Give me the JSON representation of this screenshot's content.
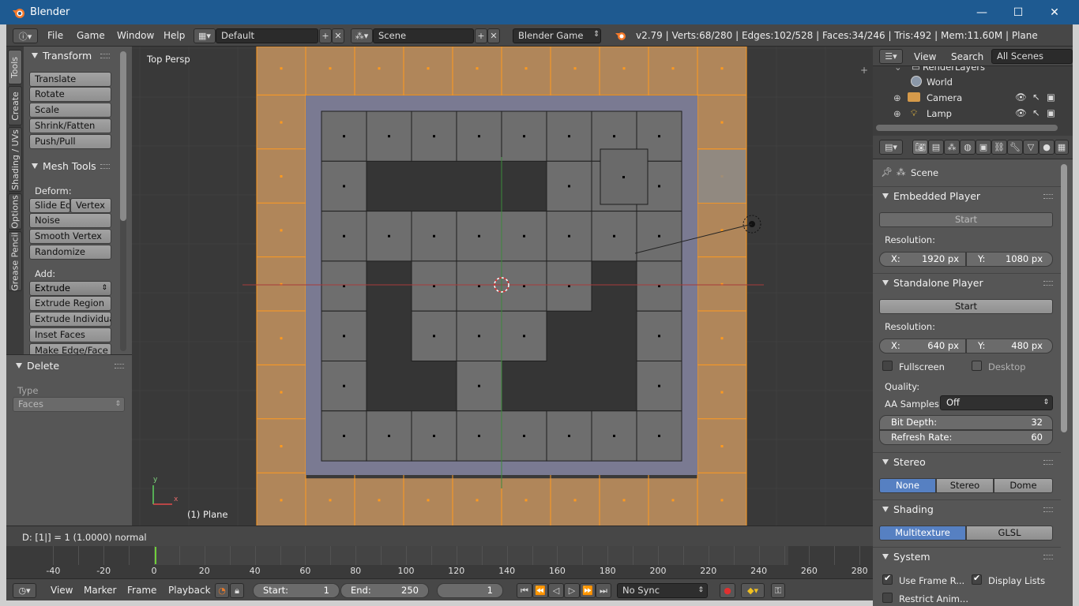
{
  "window": {
    "title": "Blender",
    "minimize": "—",
    "maximize": "☐",
    "close": "✕"
  },
  "topbar": {
    "menus": [
      "File",
      "Game",
      "Window",
      "Help"
    ],
    "screen_layout": "Default",
    "scene": "Scene",
    "engine": "Blender Game",
    "stats": "v2.79 | Verts:68/280 | Edges:102/528 | Faces:34/246 | Tris:492 | Mem:11.60M | Plane"
  },
  "tooltabs": [
    "Tools",
    "Create",
    "Shading / UVs",
    "Options",
    "Grease Pencil"
  ],
  "toolshelf": {
    "transform_title": "Transform",
    "transform_buttons": [
      "Translate",
      "Rotate",
      "Scale",
      "Shrink/Fatten",
      "Push/Pull"
    ],
    "mesh_tools_title": "Mesh Tools",
    "deform_label": "Deform:",
    "deform_left": "Slide Ed",
    "deform_right": "Vertex",
    "deform_buttons": [
      "Noise",
      "Smooth Vertex",
      "Randomize"
    ],
    "add_label": "Add:",
    "extrude_menu": "Extrude",
    "add_buttons": [
      "Extrude Region",
      "Extrude Individual",
      "Inset Faces",
      "Make Edge/Face"
    ]
  },
  "operator_panel": {
    "title": "Delete",
    "type_label": "Type",
    "type_value": "Faces"
  },
  "viewport": {
    "view_name": "Top Persp",
    "object_label": "(1) Plane",
    "axis_x": "x",
    "axis_y": "y"
  },
  "statusline": "D: [1|] = 1 (1.0000) normal",
  "timeline": {
    "ticks": [
      -40,
      -20,
      0,
      20,
      40,
      60,
      80,
      100,
      120,
      140,
      160,
      180,
      200,
      220,
      240,
      260,
      280
    ],
    "current_frame_marker": 0,
    "view": "View",
    "marker": "Marker",
    "frame": "Frame",
    "playback": "Playback",
    "start_label": "Start:",
    "start_value": "1",
    "end_label": "End:",
    "end_value": "250",
    "current": "1",
    "sync": "No Sync"
  },
  "outliner": {
    "view": "View",
    "search": "Search",
    "filter": "All Scenes",
    "items": [
      "RenderLayers",
      "World",
      "Camera",
      "Lamp"
    ]
  },
  "properties": {
    "context": "Scene",
    "embedded_title": "Embedded Player",
    "embedded_start": "Start",
    "resolution_label": "Resolution:",
    "embedded_x_label": "X:",
    "embedded_x": "1920 px",
    "embedded_y_label": "Y:",
    "embedded_y": "1080 px",
    "standalone_title": "Standalone Player",
    "standalone_start": "Start",
    "standalone_x_label": "X:",
    "standalone_x": "640 px",
    "standalone_y_label": "Y:",
    "standalone_y": "480 px",
    "fullscreen": "Fullscreen",
    "desktop": "Desktop",
    "quality_label": "Quality:",
    "aa_label": "AA Samples:",
    "aa_value": "Off",
    "bitdepth_label": "Bit Depth:",
    "bitdepth_value": "32",
    "refresh_label": "Refresh Rate:",
    "refresh_value": "60",
    "stereo_title": "Stereo",
    "stereo_none": "None",
    "stereo_stereo": "Stereo",
    "stereo_dome": "Dome",
    "shading_title": "Shading",
    "shading_multi": "Multitexture",
    "shading_glsl": "GLSL",
    "system_title": "System",
    "use_frame_rate": "Use Frame R...",
    "display_lists": "Display Lists",
    "restrict_anim": "Restrict Anim..."
  },
  "colors": {
    "selected_face": "#b0865a",
    "selected_edge": "#ff9a1f",
    "face": "#6e6e6e",
    "accent_blue": "#5680c2",
    "titlebar": "#1e5a91"
  }
}
